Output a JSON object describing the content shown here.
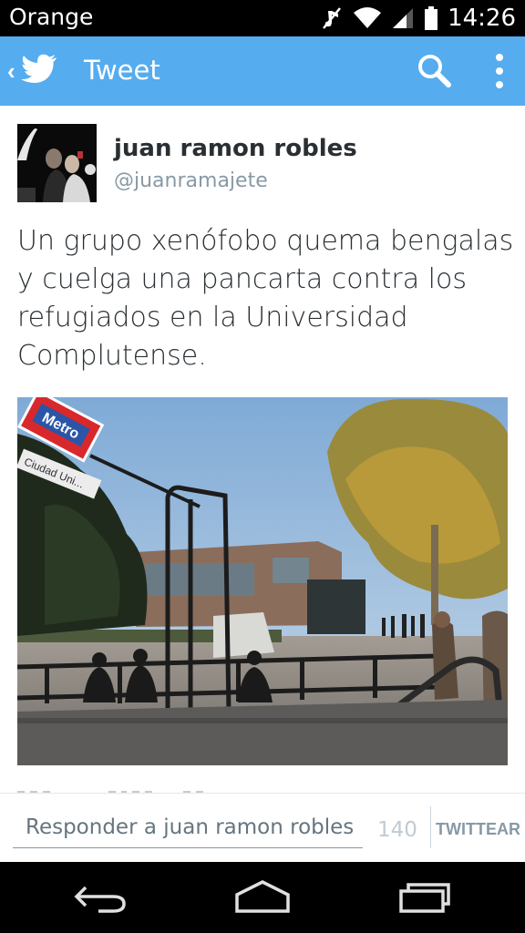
{
  "status_bar": {
    "carrier": "Orange",
    "time": "14:26",
    "icons": [
      "mute-icon",
      "wifi-icon",
      "signal-icon",
      "battery-icon"
    ]
  },
  "app_bar": {
    "title": "Tweet",
    "background": "#55acee",
    "icons": [
      "back-chevron-icon",
      "twitter-bird-icon",
      "search-icon",
      "overflow-menu-icon"
    ]
  },
  "tweet": {
    "author_name": "juan ramon robles",
    "handle": "@juanramajete",
    "text": "Un grupo xenófobo quema bengalas y cuelga una pancarta contra los refugiados en la Universidad Complutense.",
    "photo_signs": {
      "metro": "Metro",
      "street": "Ciudad Uni..."
    }
  },
  "reply_bar": {
    "placeholder": "Responder a juan ramon robles",
    "char_count": "140",
    "tweet_button": "TWITTEAR"
  },
  "nav_bar": {
    "icons": [
      "back-icon",
      "home-icon",
      "recent-apps-icon"
    ]
  }
}
